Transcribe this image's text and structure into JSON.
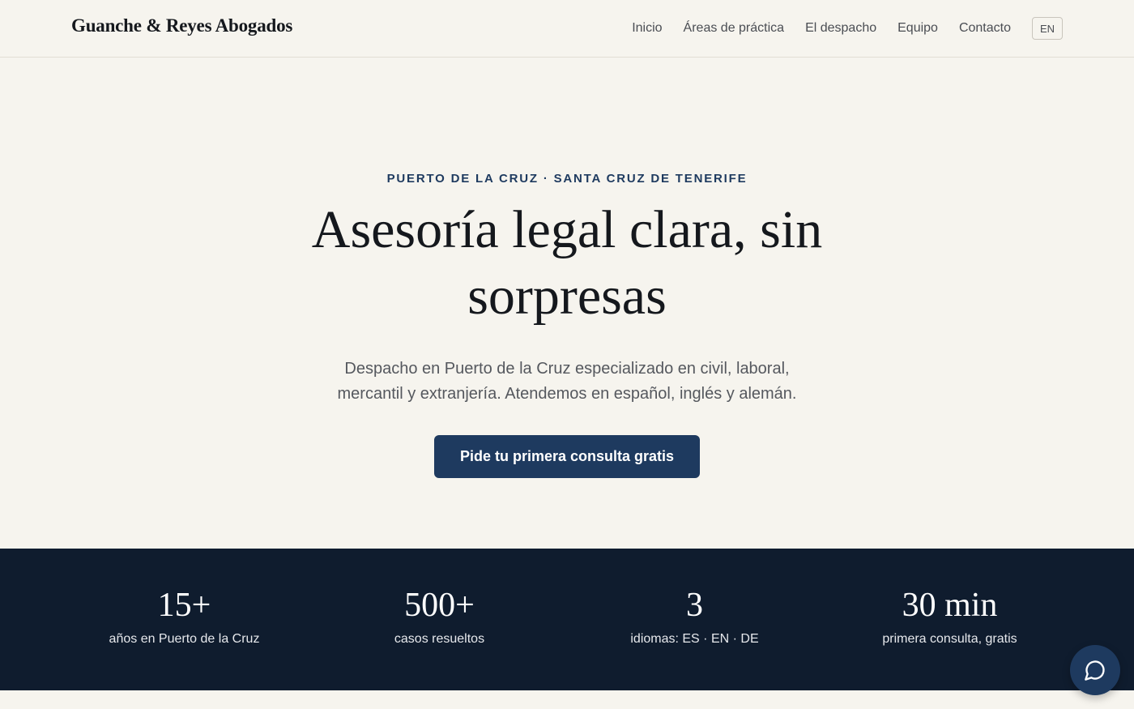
{
  "header": {
    "logo": "Guanche & Reyes Abogados",
    "nav": [
      "Inicio",
      "Áreas de práctica",
      "El despacho",
      "Equipo",
      "Contacto"
    ],
    "lang": "EN"
  },
  "hero": {
    "eyebrow": "PUERTO DE LA CRUZ · SANTA CRUZ DE TENERIFE",
    "headline": "Asesoría legal clara, sin sorpresas",
    "subtitle": "Despacho en Puerto de la Cruz especializado en civil, laboral, mercantil y extranjería. Atendemos en español, inglés y alemán.",
    "cta_label": "Pide tu primera consulta gratis"
  },
  "stats": [
    {
      "value": "15+",
      "label": "años en Puerto de la Cruz"
    },
    {
      "value": "500+",
      "label": "casos resueltos"
    },
    {
      "value": "3",
      "label": "idiomas: ES · EN · DE"
    },
    {
      "value": "30 min",
      "label": "primera consulta, gratis"
    }
  ],
  "chat": {
    "icon": "chat-bubble-icon"
  },
  "colors": {
    "background": "#f6f4ee",
    "accent": "#1e3a5f",
    "stats_band": "#0f1c2e"
  }
}
